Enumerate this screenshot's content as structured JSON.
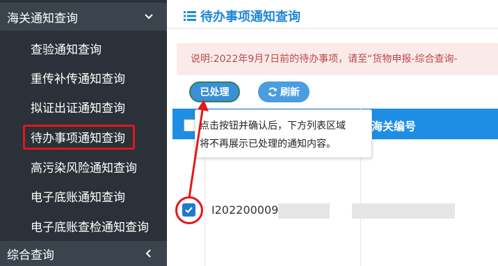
{
  "sidebar": {
    "group1_label": "海关通知查询",
    "items": [
      {
        "label": "查验通知查询"
      },
      {
        "label": "重传补传通知查询"
      },
      {
        "label": "拟证出证通知查询"
      },
      {
        "label": "待办事项通知查询"
      },
      {
        "label": "高污染风险通知查询"
      },
      {
        "label": "电子底账通知查询"
      },
      {
        "label": "电子底账查检通知查询"
      }
    ],
    "group2_label": "综合查询"
  },
  "main": {
    "title": "待办事项通知查询",
    "notice": "说明:2022年9月7日前的待办事项，请至“货物申报-综合查询-",
    "buttons": {
      "processed": "已处理",
      "refresh": "刷新"
    },
    "table": {
      "col2_header": "海关编号",
      "row1_id": "I2022000090"
    },
    "tooltip": {
      "line1": "点击按钮并确认后，下方列表区域",
      "line2": "将不再展示已处理的通知内容。"
    }
  },
  "colors": {
    "sidebar_bg": "#2a3138",
    "accent_blue": "#1e8ee5",
    "highlight_red": "#e3171c",
    "notice_bg": "#fbeaea",
    "notice_text": "#b94a48"
  }
}
